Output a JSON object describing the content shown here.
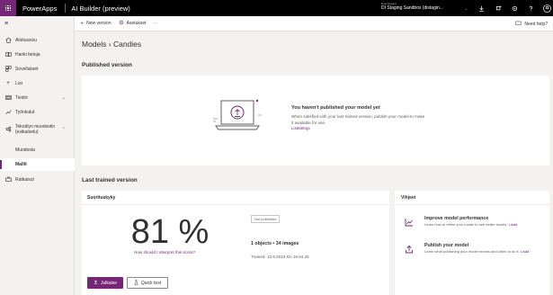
{
  "topbar": {
    "brand": "PowerApps",
    "app_name": "AI Builder (preview)",
    "environment_label": "Environment",
    "environment_value": "DI Staging Sandbox (distagin..."
  },
  "sidebar": {
    "items": [
      {
        "label": "Aloitussivu",
        "icon": "home-icon"
      },
      {
        "label": "Hanki tietoja",
        "icon": "book-icon"
      },
      {
        "label": "Sovellukset",
        "icon": "apps-icon"
      },
      {
        "label": "Luo",
        "icon": "plus-icon"
      },
      {
        "label": "Tiedot",
        "icon": "table-icon"
      },
      {
        "label": "Työnkulut",
        "icon": "flow-icon"
      },
      {
        "label": "Tekoälyn muodostin (esikatselu)",
        "icon": "brain-icon"
      },
      {
        "label": "Muodosta",
        "icon": ""
      },
      {
        "label": "Mallit",
        "icon": ""
      },
      {
        "label": "Ratkaisut",
        "icon": "solutions-icon"
      }
    ]
  },
  "commandbar": {
    "new_version": "New version",
    "settings": "Asetukset",
    "more": "···",
    "help": "Need help?"
  },
  "main": {
    "breadcrumb": "Models  ›  Candies",
    "published_heading": "Published version",
    "published": {
      "title": "You haven't published your model yet",
      "text": "When satisfied with your last trained version, publish your model to make it available for use.",
      "link": "Lisätietoja"
    },
    "last_trained_heading": "Last trained version",
    "performance": {
      "heading": "Suorituskyky",
      "score": "81 %",
      "score_value": 81,
      "interpret_link": "How should I interpret this score?",
      "badge": "Not published",
      "objects": "1 objects • 34 images",
      "trained": "Trained: 10.6.2019 klo 19.54.25",
      "publish_button": "Julkaise",
      "quick_test_button": "Quick test"
    },
    "tips": {
      "heading": "Vihjeet",
      "items": [
        {
          "title": "Improve model performance",
          "text": "Learn how to refine your model to see better results.",
          "link": "Lisää"
        },
        {
          "title": "Publish your model",
          "text": "Learn what publishing your model means and when to do it.",
          "link": "Lisää"
        }
      ]
    }
  },
  "colors": {
    "accent": "#742774",
    "topbar": "#000000",
    "background": "#f3f2f1"
  }
}
